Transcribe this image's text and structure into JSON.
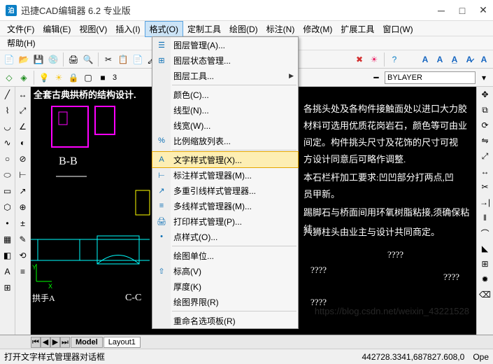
{
  "title": "迅捷CAD编辑器 6.2 专业版",
  "menubar": {
    "file": "文件(F)",
    "edit": "编辑(E)",
    "view": "视图(V)",
    "insert": "插入(I)",
    "format": "格式(O)",
    "custom_tool": "定制工具",
    "draw": "绘图(D)",
    "annotate": "标注(N)",
    "modify": "修改(M)",
    "extend_tool": "扩展工具",
    "window": "窗口(W)",
    "help": "帮助(H)"
  },
  "format_menu": {
    "layer_manage": "图层管理(A)...",
    "layer_state": "图层状态管理...",
    "layer_tools": "图层工具...",
    "color": "颜色(C)...",
    "linetype": "线型(N)...",
    "lineweight": "线宽(W)...",
    "scale_list": "比例缩放列表...",
    "text_style": "文字样式管理(X)...",
    "dim_style": "标注样式管理器(M)...",
    "mleader_style": "多重引线样式管理器...",
    "mline_style": "多线样式管理器(M)...",
    "print_style": "打印样式管理(P)...",
    "point_style": "点样式(O)...",
    "draw_units": "绘图单位...",
    "elevation": "标高(V)",
    "thickness": "厚度(K)",
    "draw_bounds": "绘图界限(R)",
    "rename": "重命名选项板(R)"
  },
  "layer": {
    "value": "BYLAYER",
    "num": "3"
  },
  "canvas": {
    "file_title": "全套古典拱桥的结构设计.",
    "label_bb": "B-B",
    "label_cc": "C-C",
    "label_handle": "拱手A",
    "text1": "各挑头处及各构件接触面处以进口大力胶",
    "text2": "材料可选用优质花岗岩石，颜色等可由业",
    "text3": "间定。构件挑头尺寸及花饰的尺寸可视",
    "text4": "方设计同意后可略作调整.",
    "text5": "本石栏杆加工要求:凹凹部分打两点,凹",
    "text6": "员甲新。",
    "text7": "踢脚石与桥面间用环氧树脂粘接,须确保粘结",
    "text8": "八狮柱头由业主与设计共同商定。",
    "q": "????"
  },
  "tabs": {
    "model": "Model",
    "layout1": "Layout1"
  },
  "status": {
    "left": "打开文字样式管理器对话框",
    "coords": "442728.3341,687827.608,0",
    "right": "Ope"
  },
  "watermark": "https://blog.csdn.net/weixin_43221528"
}
